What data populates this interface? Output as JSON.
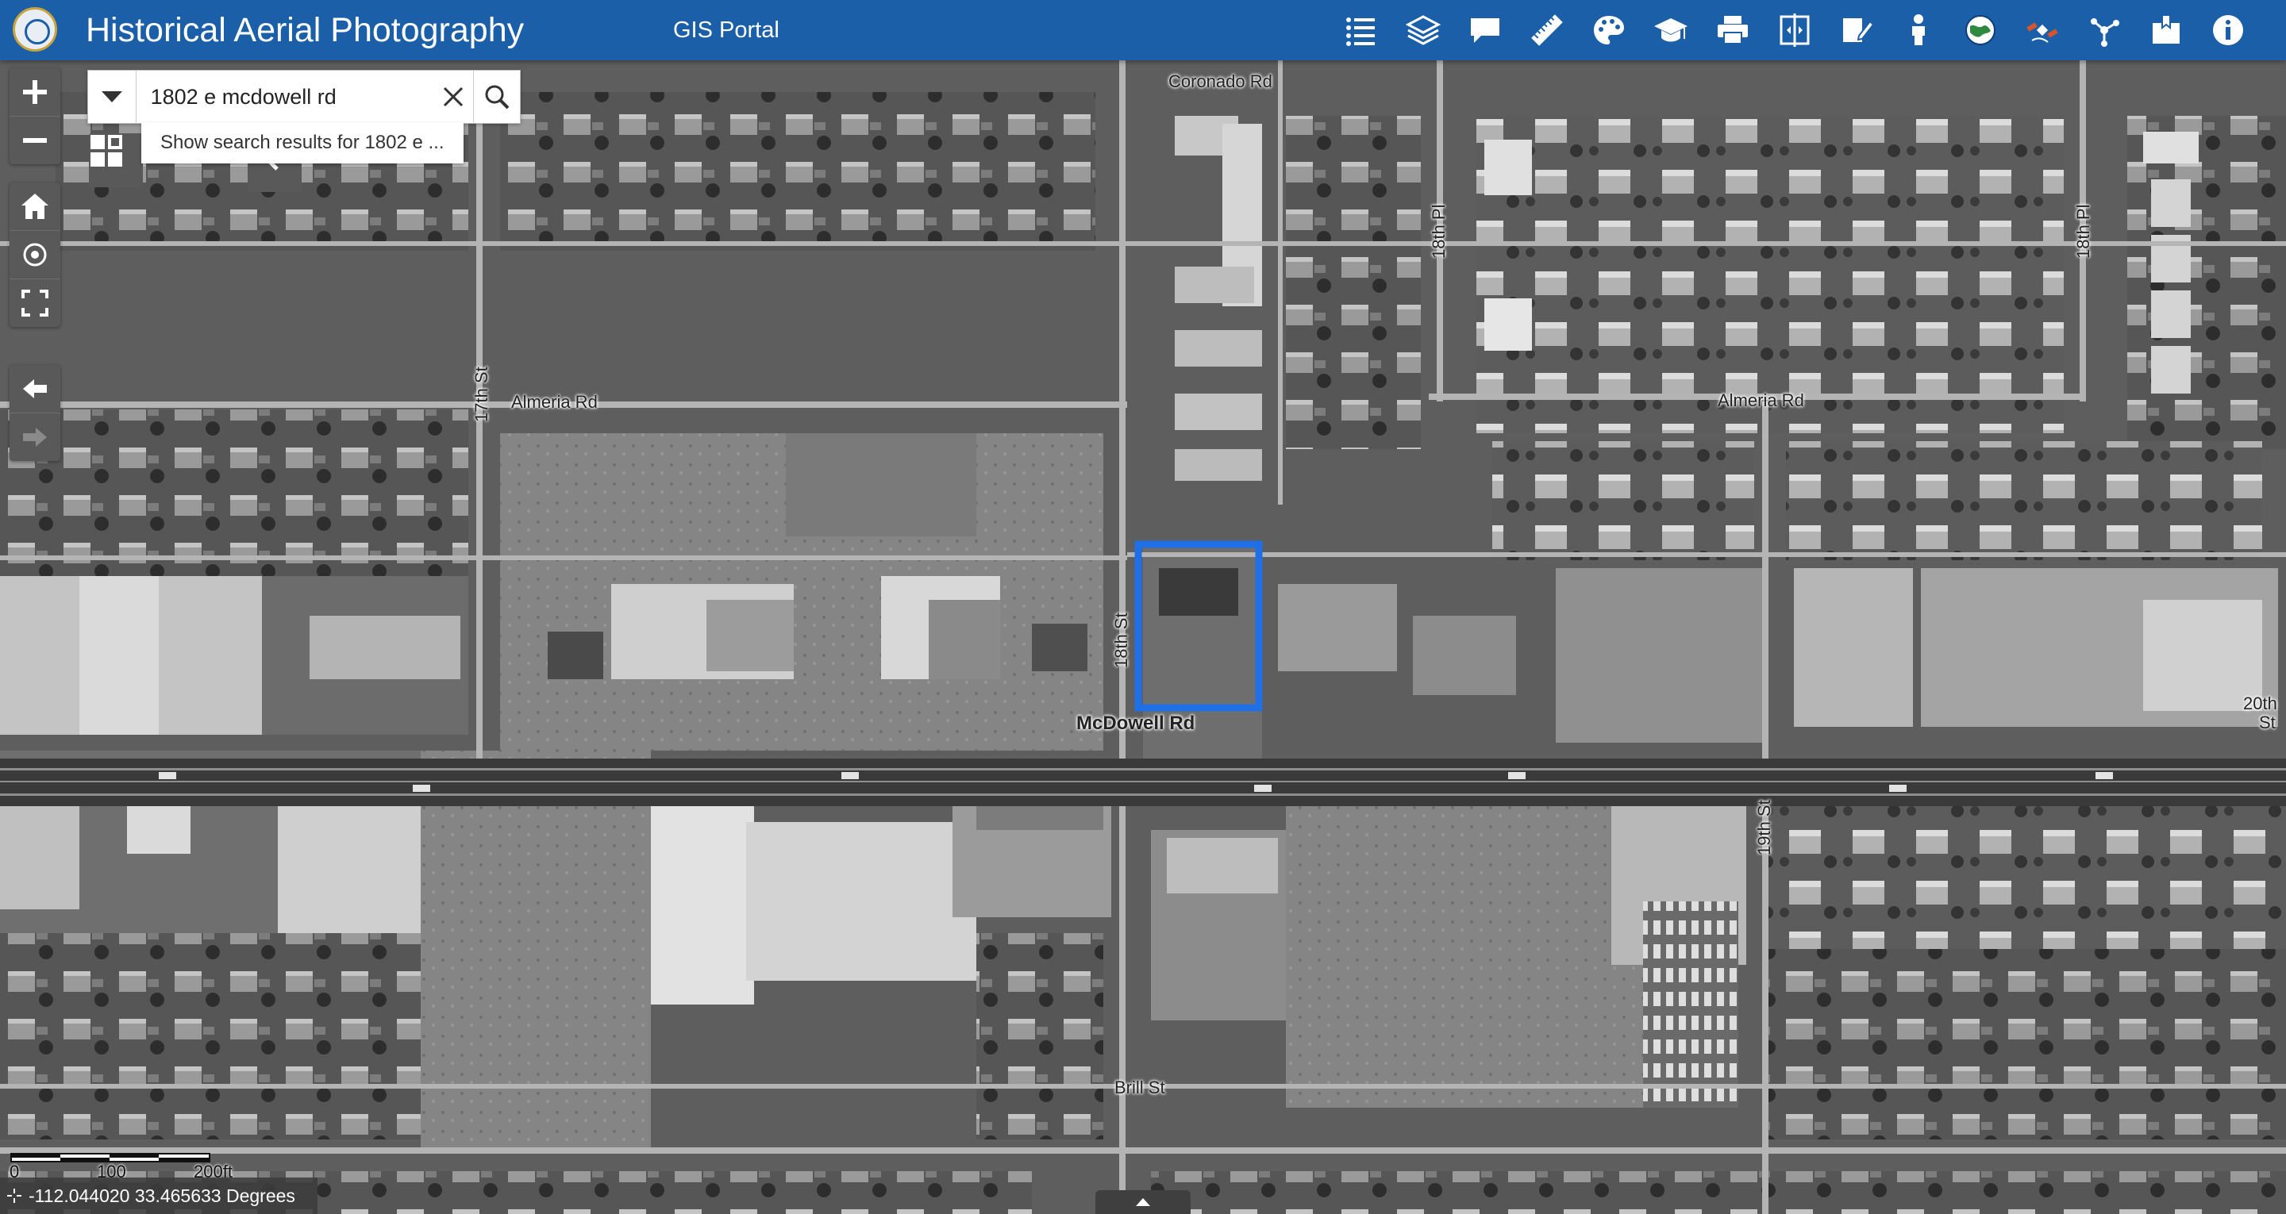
{
  "header": {
    "title": "Historical Aerial Photography",
    "subtitle": "GIS Portal",
    "bg_color": "#1a5fa8",
    "tools": [
      {
        "name": "layer-list-icon"
      },
      {
        "name": "layers-icon"
      },
      {
        "name": "chat-icon"
      },
      {
        "name": "measure-ruler-icon"
      },
      {
        "name": "palette-icon"
      },
      {
        "name": "graduation-cap-icon"
      },
      {
        "name": "print-icon"
      },
      {
        "name": "swipe-compare-icon"
      },
      {
        "name": "edit-note-icon"
      },
      {
        "name": "person-icon"
      },
      {
        "name": "globe-icon"
      },
      {
        "name": "satellite-icon"
      },
      {
        "name": "share-icon"
      },
      {
        "name": "bookmark-icon"
      },
      {
        "name": "info-icon"
      }
    ]
  },
  "search": {
    "value": "1802 e mcdowell rd",
    "suggestion": "Show search results for 1802 e ..."
  },
  "map": {
    "streets": [
      {
        "label": "Coronado Rd"
      },
      {
        "label": "Almeria Rd"
      },
      {
        "label": "Almeria Rd"
      },
      {
        "label": "McDowell Rd"
      },
      {
        "label": "Brill St"
      },
      {
        "label": "17th St"
      },
      {
        "label": "18th St"
      },
      {
        "label": "18th Pl"
      },
      {
        "label": "18th Pl"
      },
      {
        "label": "19th St"
      },
      {
        "label": "20th"
      },
      {
        "label": "St"
      }
    ],
    "highlight_color": "#1f6fe6"
  },
  "scale": {
    "labels": [
      "0",
      "100",
      "200ft"
    ]
  },
  "coordinates": "-112.044020 33.465633 Degrees"
}
